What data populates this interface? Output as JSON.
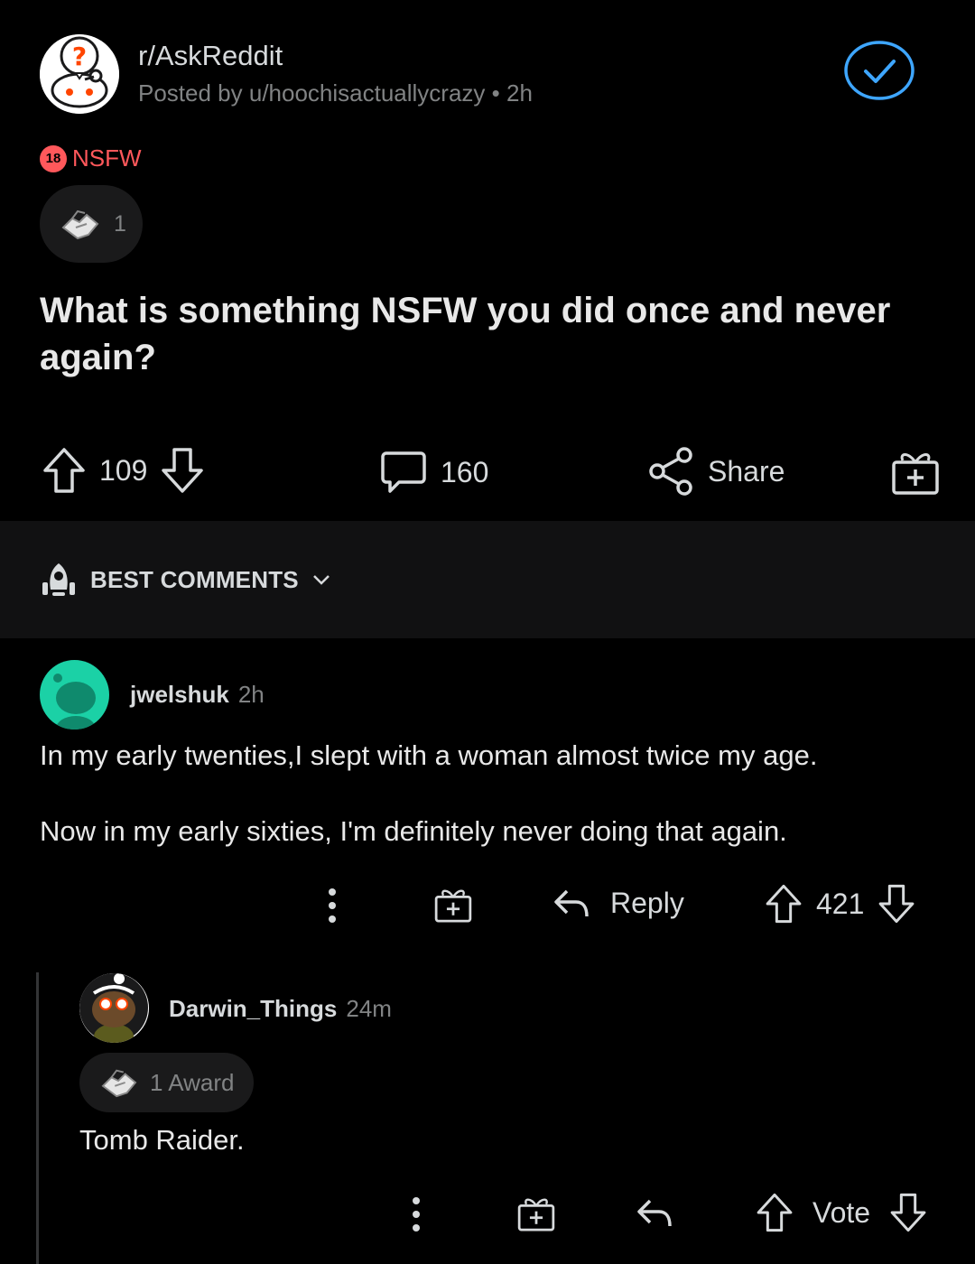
{
  "post": {
    "subreddit": "r/AskReddit",
    "posted_by": "Posted by u/hoochisactuallycrazy",
    "posted_sep": "•",
    "posted_age": "2h",
    "nsfw_badge": "18",
    "nsfw_label": "NSFW",
    "award_count": "1",
    "title": "What is something NSFW you did once and never again?",
    "upvotes": "109",
    "comment_count": "160",
    "share_label": "Share"
  },
  "sort": {
    "label": "BEST COMMENTS"
  },
  "comments": [
    {
      "author": "jwelshuk",
      "age": "2h",
      "body_lines": [
        "In my early twenties,I slept with a woman almost twice my age.",
        "Now in my early sixties, I'm definitely never doing that again."
      ],
      "reply_label": "Reply",
      "score": "421"
    },
    {
      "author": "Darwin_Things",
      "age": "24m",
      "award_label": "1 Award",
      "body": "Tomb Raider.",
      "vote_label": "Vote"
    }
  ],
  "colors": {
    "background": "#000000",
    "text": "#d7dadc",
    "muted": "#818384",
    "nsfw": "#ff585b",
    "joined_blue": "#3ea6ff",
    "avatar_teal": "#1bd1a6"
  },
  "icons": {
    "subreddit": "askreddit-snoo-icon",
    "joined": "checkmark-circle-icon",
    "award": "handshake-award-icon",
    "upvote": "arrow-up-icon",
    "downvote": "arrow-down-icon",
    "comments": "speech-bubble-icon",
    "share": "share-nodes-icon",
    "gift": "gift-award-icon",
    "sort": "rocket-icon",
    "more": "vertical-dots-icon",
    "reply": "reply-arrow-icon"
  }
}
